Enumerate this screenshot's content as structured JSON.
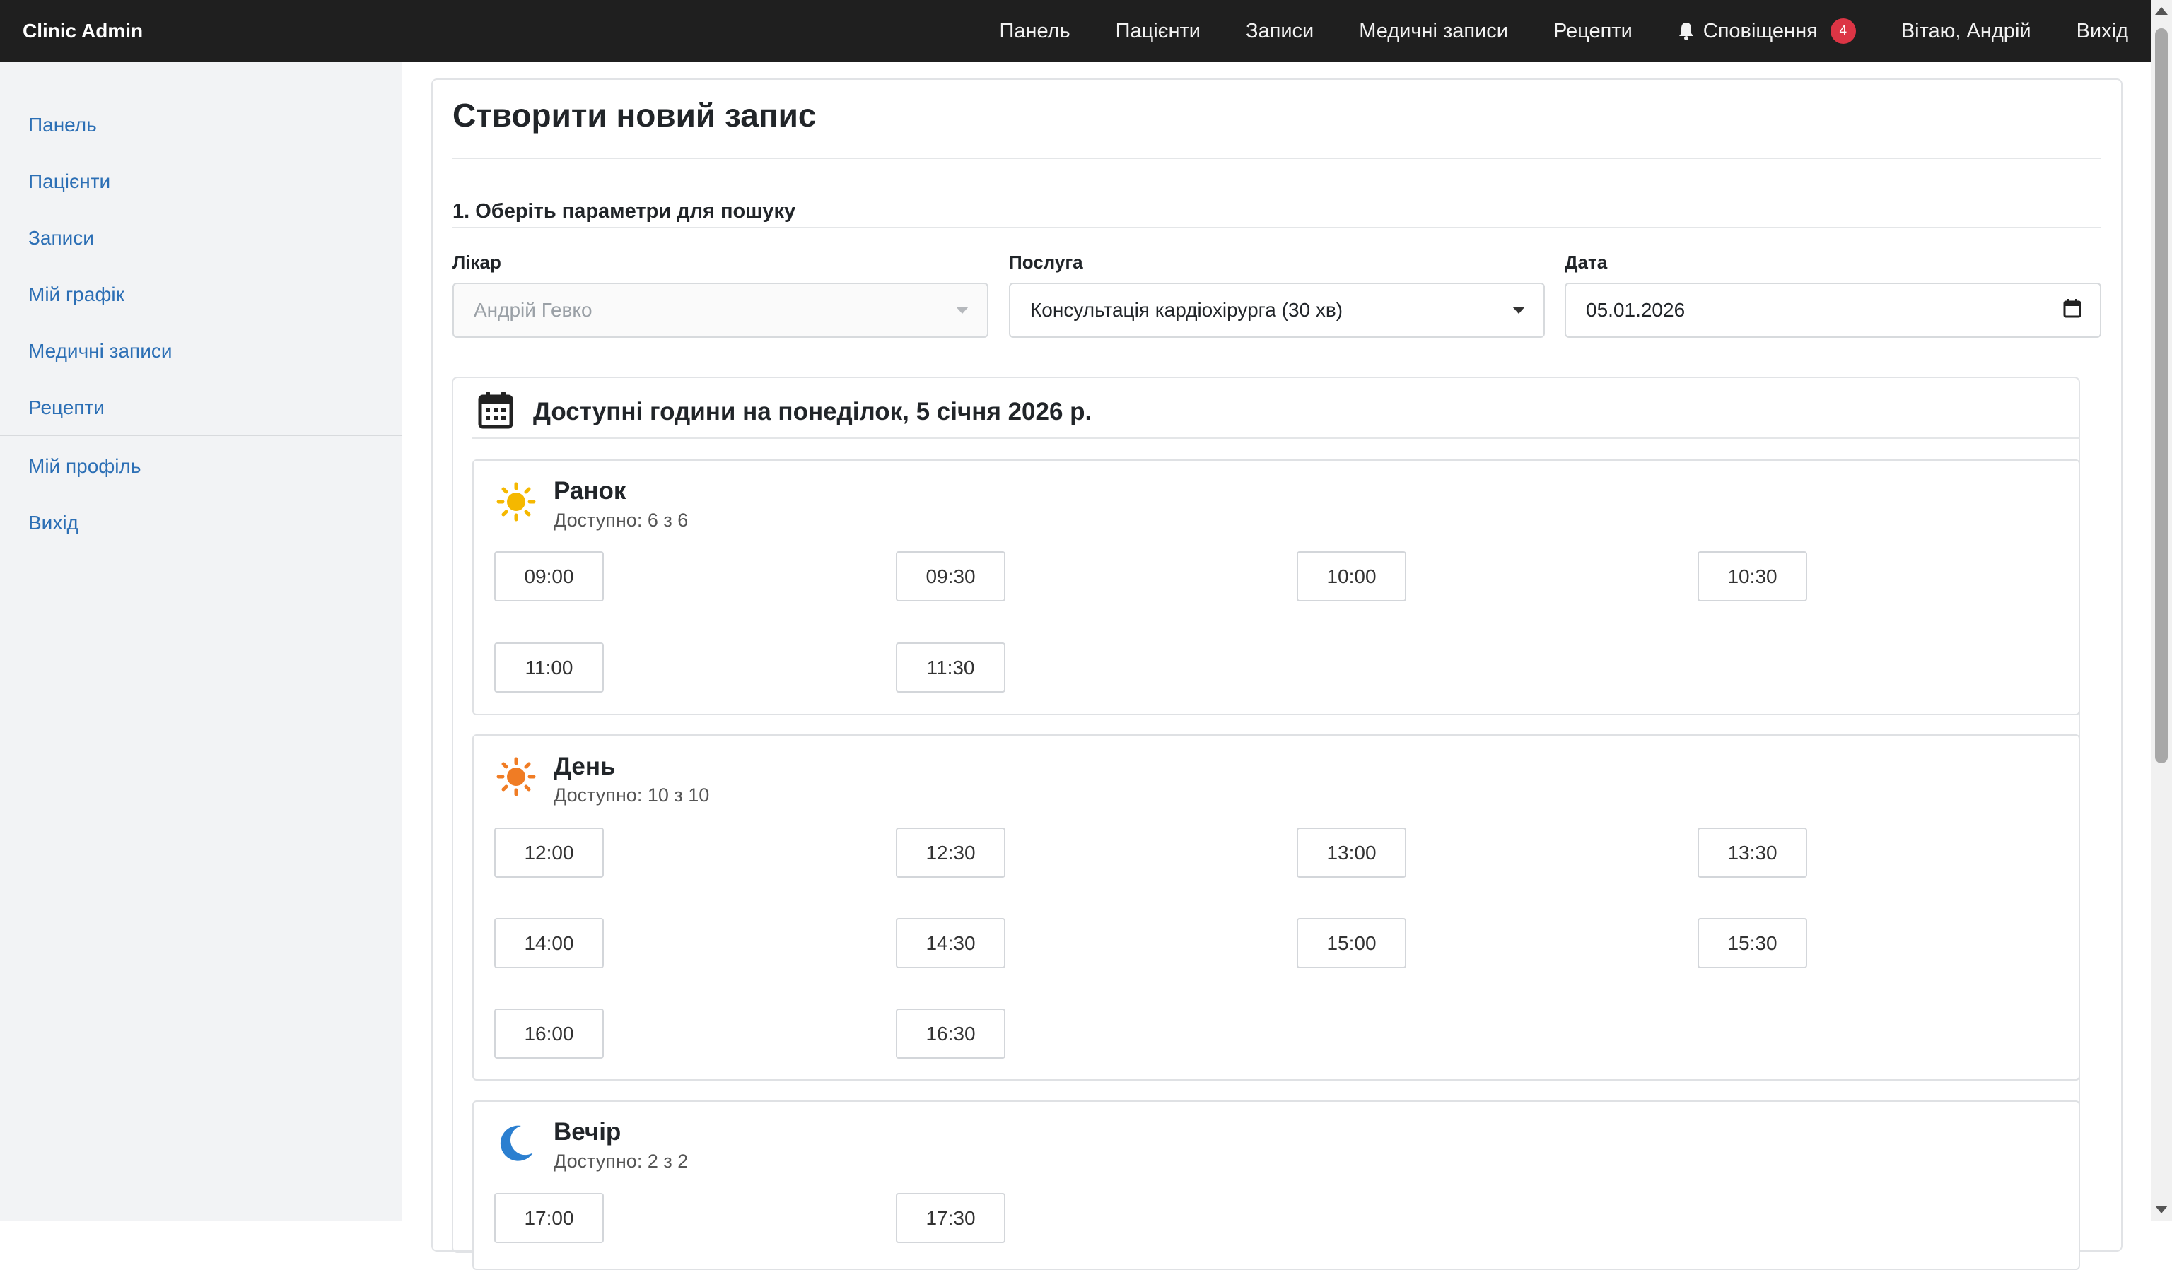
{
  "brand": "Clinic Admin",
  "topnav": {
    "items": [
      "Панель",
      "Пацієнти",
      "Записи",
      "Медичні записи",
      "Рецепти"
    ],
    "notifications_label": "Сповіщення",
    "notifications_count": "4",
    "greeting": "Вітаю, Андрій",
    "logout": "Вихід"
  },
  "sidebar": {
    "items": [
      "Панель",
      "Пацієнти",
      "Записи",
      "Мій графік",
      "Медичні записи",
      "Рецепти"
    ],
    "secondary": [
      "Мій профіль",
      "Вихід"
    ]
  },
  "page": {
    "title": "Створити новий запис",
    "section_title": "1. Оберіть параметри для пошуку"
  },
  "form": {
    "doctor_label": "Лікар",
    "doctor_value": "Андрій Гевко",
    "service_label": "Послуга",
    "service_value": "Консультація кардіохірурга (30 хв)",
    "date_label": "Дата",
    "date_value": "05.01.2026"
  },
  "slots": {
    "title": "Доступні години на понеділок, 5 січня 2026 р.",
    "morning": {
      "name": "Ранок",
      "availability": "Доступно: 6 з 6",
      "times": [
        "09:00",
        "09:30",
        "10:00",
        "10:30",
        "11:00",
        "11:30"
      ]
    },
    "day": {
      "name": "День",
      "availability": "Доступно: 10 з 10",
      "times": [
        "12:00",
        "12:30",
        "13:00",
        "13:30",
        "14:00",
        "14:30",
        "15:00",
        "15:30",
        "16:00",
        "16:30"
      ]
    },
    "evening": {
      "name": "Вечір",
      "availability": "Доступно: 2 з 2",
      "times": [
        "17:00",
        "17:30"
      ]
    }
  },
  "icons": {
    "notifications": "bell-icon",
    "calendar": "calendar-icon",
    "morning": "sun-icon",
    "day": "sun-icon",
    "evening": "moon-icon"
  },
  "colors": {
    "topbar": "#1f1f1f",
    "link": "#2c6fb5",
    "badge": "#dc3545",
    "sun_morning": "#f5b800",
    "sun_day": "#f07c24",
    "moon": "#2b7fd0"
  }
}
